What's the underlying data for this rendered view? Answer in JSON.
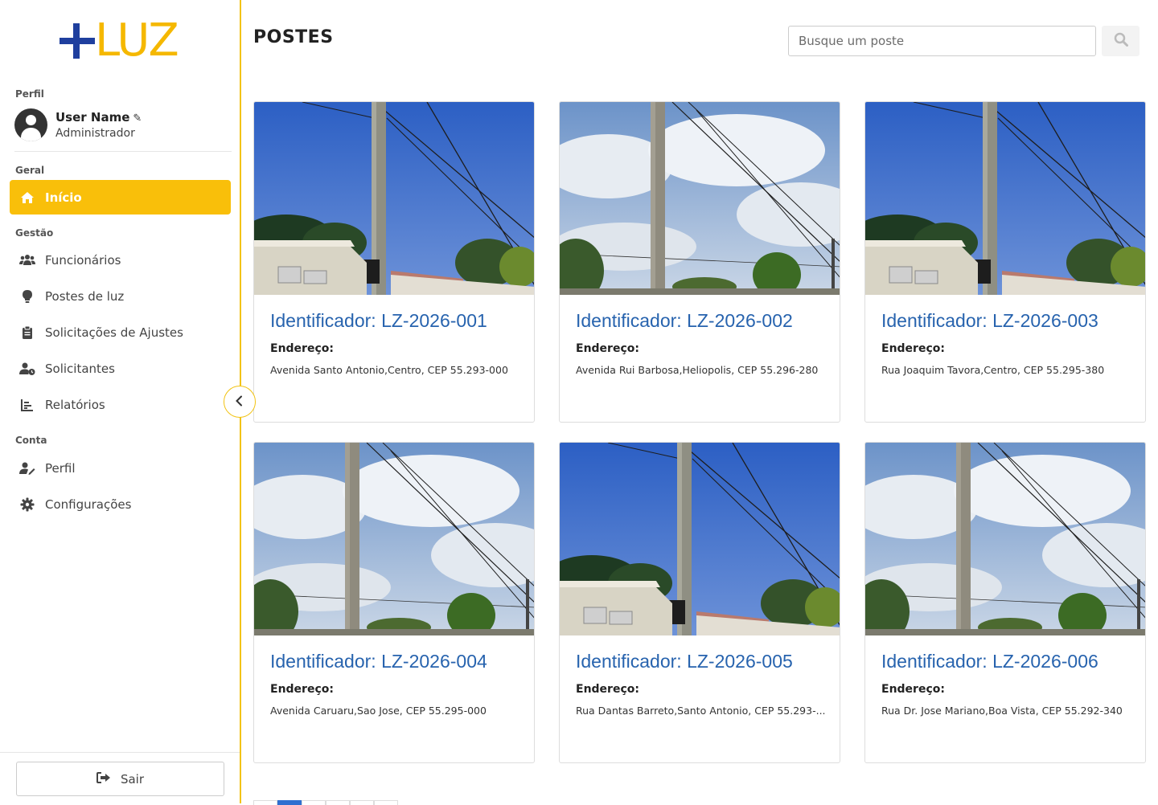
{
  "logo": {
    "text": "LUZ"
  },
  "sidebar": {
    "profile_section": "Perfil",
    "user": {
      "name": "User Name",
      "role": "Administrador"
    },
    "sections": {
      "geral": "Geral",
      "gestao": "Gestão",
      "conta": "Conta"
    },
    "items": [
      {
        "label": "Início",
        "icon": "home-icon"
      },
      {
        "label": "Funcionários",
        "icon": "users-icon"
      },
      {
        "label": "Postes de luz",
        "icon": "lightbulb-icon"
      },
      {
        "label": "Solicitações de Ajustes",
        "icon": "clipboard-icon"
      },
      {
        "label": "Solicitantes",
        "icon": "user-clock-icon"
      },
      {
        "label": "Relatórios",
        "icon": "chart-icon"
      },
      {
        "label": "Perfil",
        "icon": "user-edit-icon"
      },
      {
        "label": "Configurações",
        "icon": "gear-icon"
      }
    ],
    "logout_label": "Sair"
  },
  "header": {
    "title": "POSTES",
    "search_placeholder": "Busque um poste"
  },
  "cards": [
    {
      "id": "Identificador: LZ-2026-001",
      "addr_label": "Endereço:",
      "addr": "Avenida Santo Antonio,Centro, CEP 55.293-000"
    },
    {
      "id": "Identificador: LZ-2026-002",
      "addr_label": "Endereço:",
      "addr": "Avenida Rui Barbosa,Heliopolis, CEP 55.296-280"
    },
    {
      "id": "Identificador: LZ-2026-003",
      "addr_label": "Endereço:",
      "addr": "Rua Joaquim Tavora,Centro, CEP 55.295-380"
    },
    {
      "id": "Identificador: LZ-2026-004",
      "addr_label": "Endereço:",
      "addr": "Avenida Caruaru,Sao Jose, CEP 55.295-000"
    },
    {
      "id": "Identificador: LZ-2026-005",
      "addr_label": "Endereço:",
      "addr": "Rua Dantas Barreto,Santo Antonio, CEP 55.293-..."
    },
    {
      "id": "Identificador: LZ-2026-006",
      "addr_label": "Endereço:",
      "addr": "Rua Dr. Jose Mariano,Boa Vista, CEP 55.292-340"
    }
  ],
  "colors": {
    "accent": "#f9bf0a",
    "brand_blue": "#1f3f9e",
    "link_blue": "#2763ae"
  }
}
